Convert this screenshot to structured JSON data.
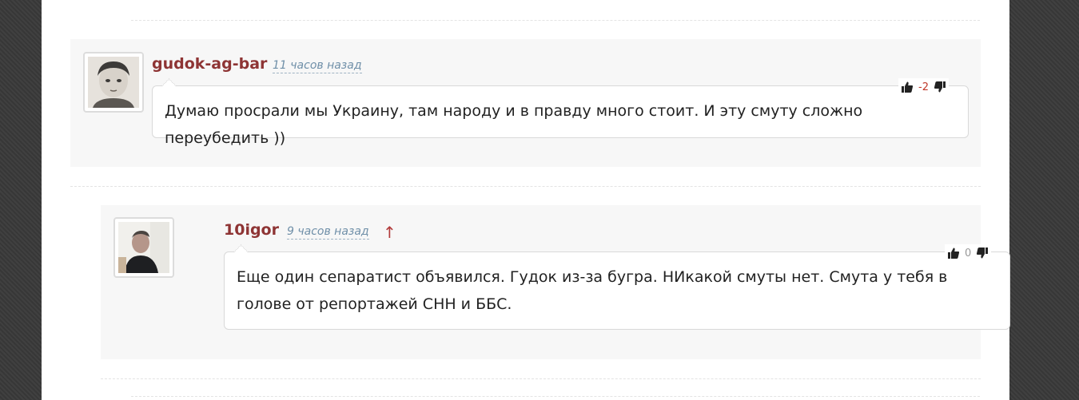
{
  "comments": [
    {
      "author": "gudok-ag-bar",
      "time": "11 часов назад",
      "score": "-2",
      "text": "Думаю просрали мы Украину, там народу и в правду много стоит. И эту смуту сложно переубедить ))"
    },
    {
      "author": "10igor",
      "time": "9 часов назад",
      "parent_link": "↑",
      "score": "0",
      "text": "Еще один сепаратист объявился. Гудок из-за бугра. НИкакой смуты нет. Смута у тебя в голове от репортажей СНН и ББС."
    }
  ],
  "icons": {
    "vote_up": "thumbs-up-icon",
    "vote_down": "thumbs-down-icon"
  },
  "colors": {
    "author": "#8e3434",
    "timestamp": "#6f8fa8",
    "negative_score": "#c0392b",
    "zero_score": "#999999"
  }
}
